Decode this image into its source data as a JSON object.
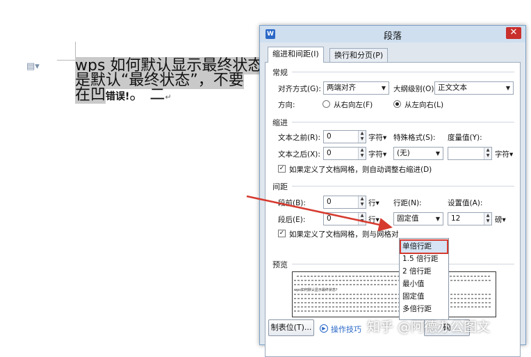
{
  "document": {
    "line1": "wps 如何默认显示最终状态",
    "line2": "是默认“最终状态”，不要",
    "line3_start": "在凹",
    "line3_error": "错误!",
    "line3_end": "。 二",
    "para_mark": "↵"
  },
  "dialog": {
    "app_icon": "W",
    "title": "段落",
    "close": "✕",
    "tabs": [
      "缩进和间距(I)",
      "换行和分页(P)"
    ],
    "general": {
      "section": "常规",
      "align_label": "对齐方式(G):",
      "align_value": "两端对齐",
      "outline_label": "大纲级别(O):",
      "outline_value": "正文文本",
      "direction_label": "方向:",
      "rtl": "从右向左(F)",
      "ltr": "从左向右(L)"
    },
    "indent": {
      "section": "缩进",
      "before_label": "文本之前(R):",
      "before_value": "0",
      "before_unit": "字符▾",
      "after_label": "文本之后(X):",
      "after_value": "0",
      "after_unit": "字符▾",
      "special_label": "特殊格式(S):",
      "special_value": "(无)",
      "measure_label": "度量值(Y):",
      "measure_value": "",
      "measure_unit": "字符▾",
      "grid_check": "如果定义了文档网格，则自动调整右缩进(D)"
    },
    "spacing": {
      "section": "间距",
      "before_label": "段前(B):",
      "before_value": "0",
      "before_unit": "行▾",
      "after_label": "段后(E):",
      "after_value": "0",
      "after_unit": "行▾",
      "line_label": "行距(N):",
      "line_value": "固定值",
      "set_label": "设置值(A):",
      "set_value": "12",
      "set_unit": "磅▾",
      "grid_check": "如果定义了文档网格，则与网格对"
    },
    "line_options": [
      "单倍行距",
      "1.5 倍行距",
      "2 倍行距",
      "最小值",
      "固定值",
      "多倍行距"
    ],
    "preview": {
      "section": "预览",
      "sample": "wps如何默认显示最终状态?"
    },
    "bottom": {
      "tabs_button": "制表位(T)...",
      "tips_link": "操作技巧",
      "ok": "确"
    }
  },
  "watermark": "知乎 @阿德办公图文",
  "colors": {
    "accent": "#2b68c7",
    "highlight_border": "#d63a2f",
    "arrow": "#d63a2f"
  }
}
